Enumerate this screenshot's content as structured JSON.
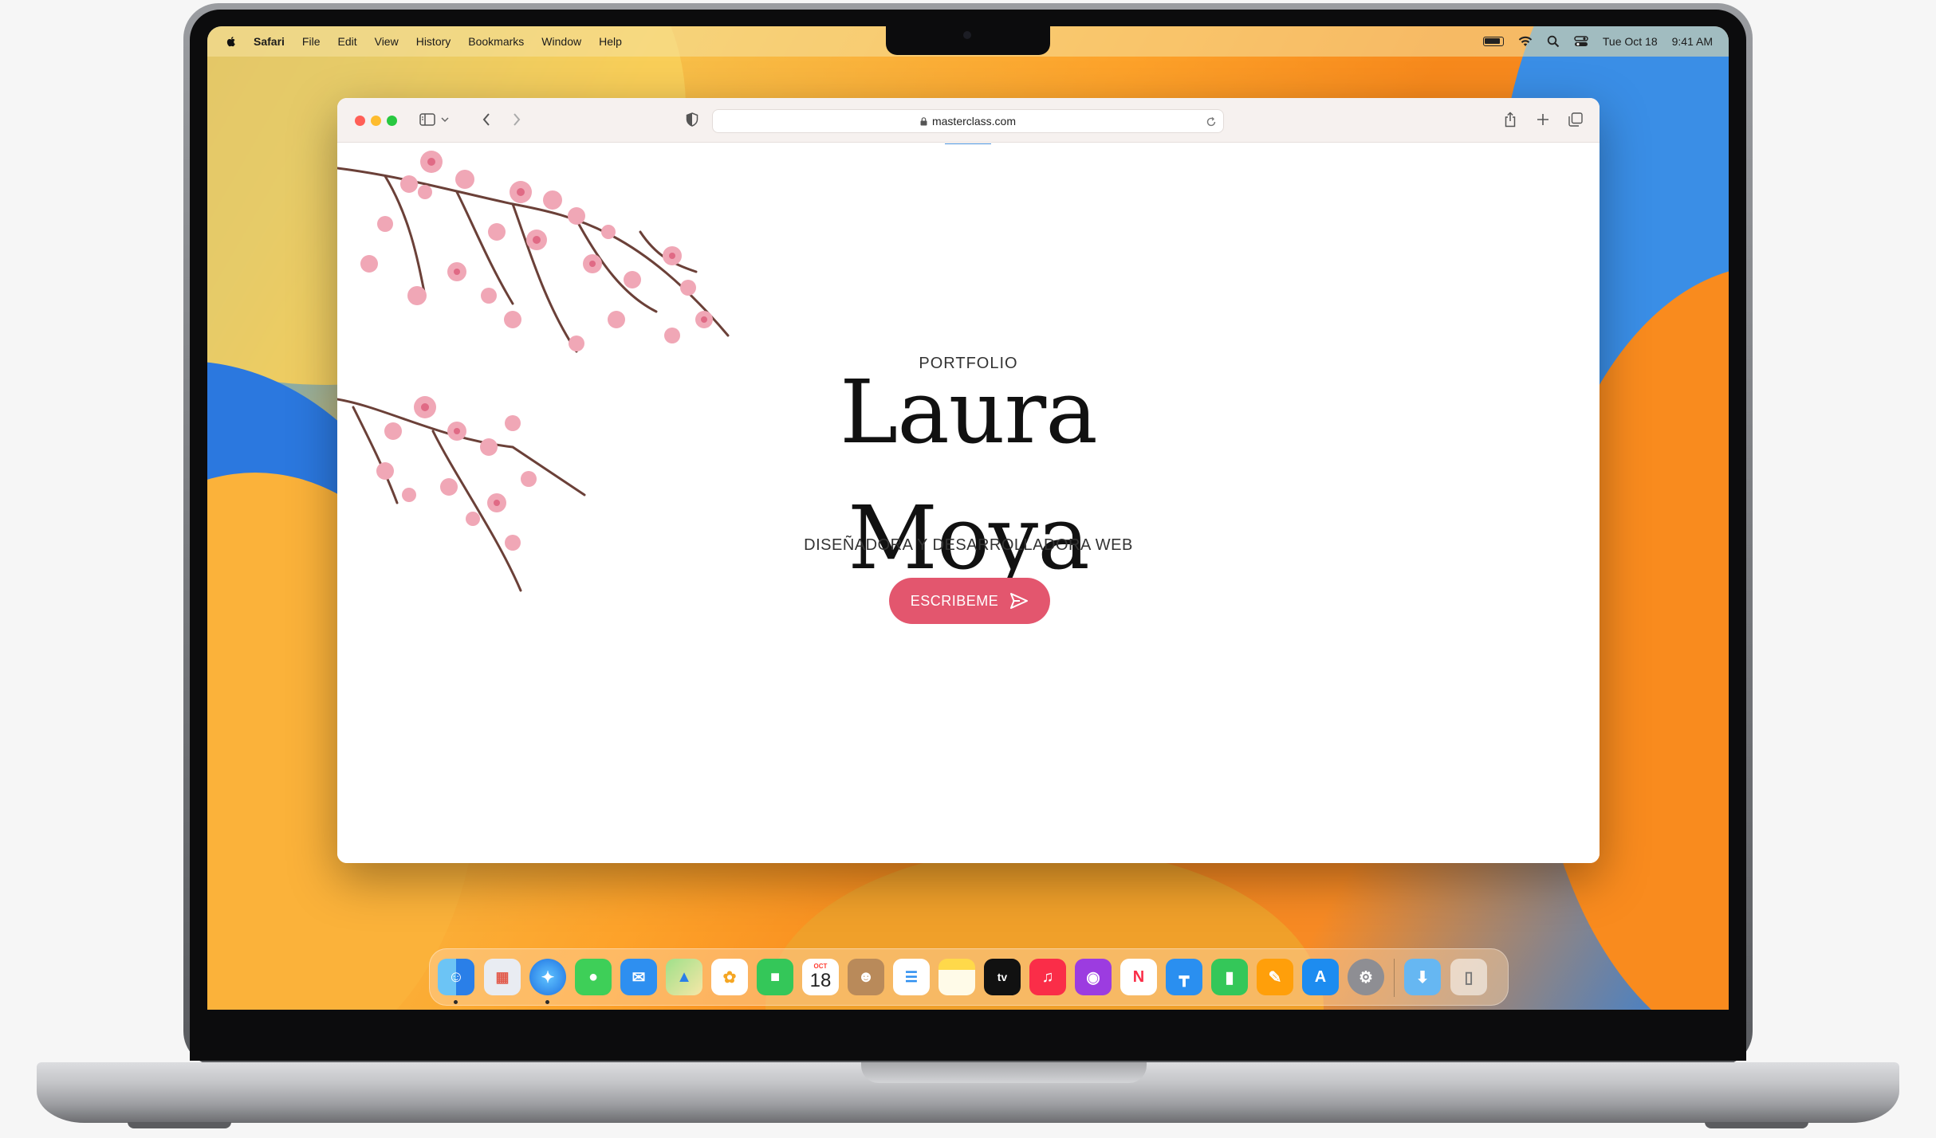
{
  "menubar": {
    "app_name": "Safari",
    "items": [
      "File",
      "Edit",
      "View",
      "History",
      "Bookmarks",
      "Window",
      "Help"
    ],
    "date": "Tue Oct 18",
    "time": "9:41 AM"
  },
  "browser": {
    "url": "masterclass.com"
  },
  "page": {
    "kicker": "PORTFOLIO",
    "first_name": "Laura",
    "last_name": "Moya",
    "subtitle": "DISEÑADORA Y DESARROLLADORA WEB",
    "cta_label": "ESCRIBEME",
    "accent_color": "#e3566e"
  },
  "dock": {
    "calendar_month": "OCT",
    "calendar_day": "18",
    "tv_label": "tv",
    "apps": [
      "Finder",
      "Launchpad",
      "Safari",
      "Messages",
      "Mail",
      "Maps",
      "Photos",
      "FaceTime",
      "Calendar",
      "Contacts",
      "Reminders",
      "Notes",
      "TV",
      "Music",
      "Podcasts",
      "News",
      "Keynote",
      "Numbers",
      "Pages",
      "App Store",
      "System Settings",
      "Downloads",
      "Trash"
    ]
  }
}
